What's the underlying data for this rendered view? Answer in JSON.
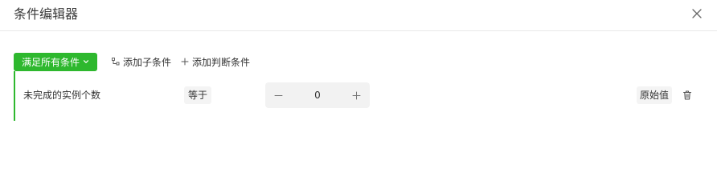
{
  "dialog": {
    "title": "条件编辑器",
    "close_icon": "close-icon"
  },
  "toolbar": {
    "match_label": "满足所有条件",
    "match_icon": "chevron-down-icon",
    "add_sub_label": "添加子条件",
    "add_sub_icon": "tree-icon",
    "add_judge_label": "添加判断条件",
    "add_judge_icon": "plus-icon"
  },
  "condition": {
    "field": "未完成的实例个数",
    "operator": "等于",
    "value": "0",
    "minus_icon": "minus-icon",
    "plus_icon": "plus-icon",
    "raw_label": "原始值",
    "delete_icon": "trash-icon"
  },
  "colors": {
    "accent": "#2eb82e",
    "divider": "#e8e8e8",
    "control_bg": "#f2f2f2"
  }
}
